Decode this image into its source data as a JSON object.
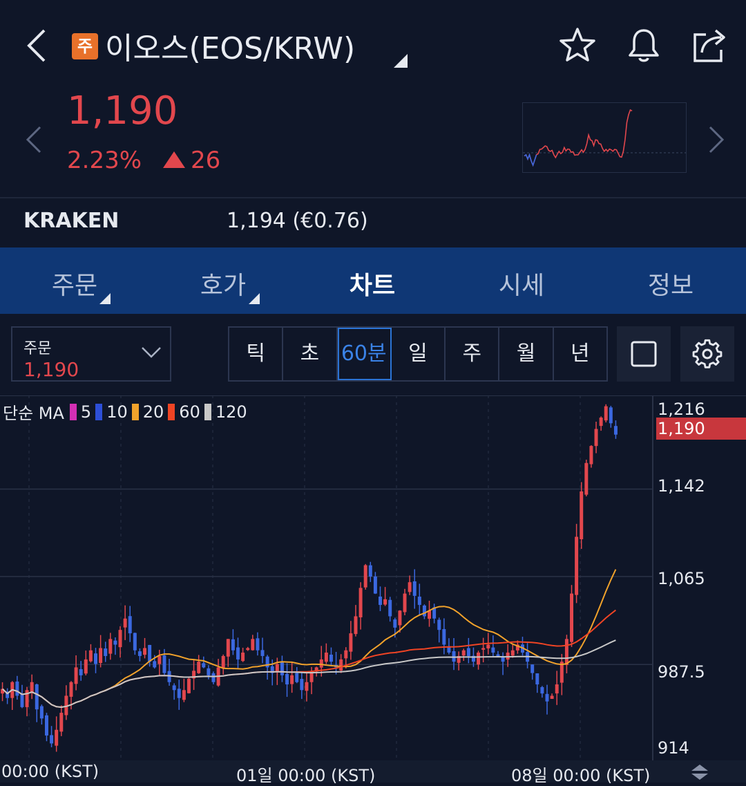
{
  "header": {
    "badge": "주",
    "title": "이오스(EOS/KRW)"
  },
  "price": {
    "current": "1,190",
    "change_pct": "2.23%",
    "change_abs": "26"
  },
  "exchange": {
    "name": "KRAKEN",
    "value": "1,194 (€0.76)"
  },
  "tabs": [
    {
      "label": "주문"
    },
    {
      "label": "호가"
    },
    {
      "label": "차트"
    },
    {
      "label": "시세"
    },
    {
      "label": "정보"
    }
  ],
  "order_select": {
    "label": "주문",
    "value": "1,190"
  },
  "timeframes": [
    {
      "label": "틱"
    },
    {
      "label": "초"
    },
    {
      "label": "60분"
    },
    {
      "label": "일"
    },
    {
      "label": "주"
    },
    {
      "label": "월"
    },
    {
      "label": "년"
    }
  ],
  "colors": {
    "up": "#e2474d",
    "down": "#3b68e0",
    "ma5": "#d42fb4",
    "ma10": "#2d4fd8",
    "ma20": "#f1a22b",
    "ma60": "#f04424",
    "ma120": "#c8c8c8",
    "tab_bar": "#0f3775"
  },
  "chart_data": {
    "type": "candlestick",
    "legend": {
      "prefix": "단순 MA",
      "items": [
        "5",
        "10",
        "20",
        "60",
        "120"
      ]
    },
    "y_ticks": [
      "1,216",
      "1,142",
      "1,065",
      "987.5",
      "914"
    ],
    "current_price_label": "1,190",
    "x_ticks": [
      "00:00 (KST)",
      "01일 00:00 (KST)",
      "08일 00:00 (KST)"
    ],
    "ylim": [
      914,
      1216
    ],
    "close_series": [
      966,
      958,
      972,
      960,
      950,
      965,
      972,
      948,
      940,
      925,
      918,
      930,
      945,
      960,
      972,
      985,
      978,
      992,
      1000,
      988,
      1002,
      995,
      1010,
      1005,
      1018,
      1028,
      1015,
      1000,
      995,
      1002,
      990,
      985,
      995,
      980,
      972,
      965,
      958,
      965,
      975,
      982,
      990,
      985,
      978,
      972,
      985,
      995,
      1010,
      1000,
      992,
      998,
      1002,
      1010,
      1000,
      995,
      985,
      980,
      988,
      978,
      970,
      978,
      972,
      965,
      972,
      980,
      985,
      992,
      998,
      990,
      985,
      992,
      1000,
      1015,
      1030,
      1055,
      1075,
      1065,
      1050,
      1040,
      1045,
      1030,
      1020,
      1035,
      1050,
      1060,
      1048,
      1040,
      1030,
      1035,
      1028,
      1018,
      1005,
      998,
      990,
      995,
      1000,
      995,
      990,
      998,
      1002,
      1005,
      998,
      995,
      990,
      998,
      1000,
      1005,
      998,
      990,
      980,
      970,
      962,
      955,
      960,
      970,
      990,
      1010,
      1050,
      1100,
      1140,
      1165,
      1180,
      1195,
      1205,
      1215,
      1200,
      1190
    ]
  }
}
